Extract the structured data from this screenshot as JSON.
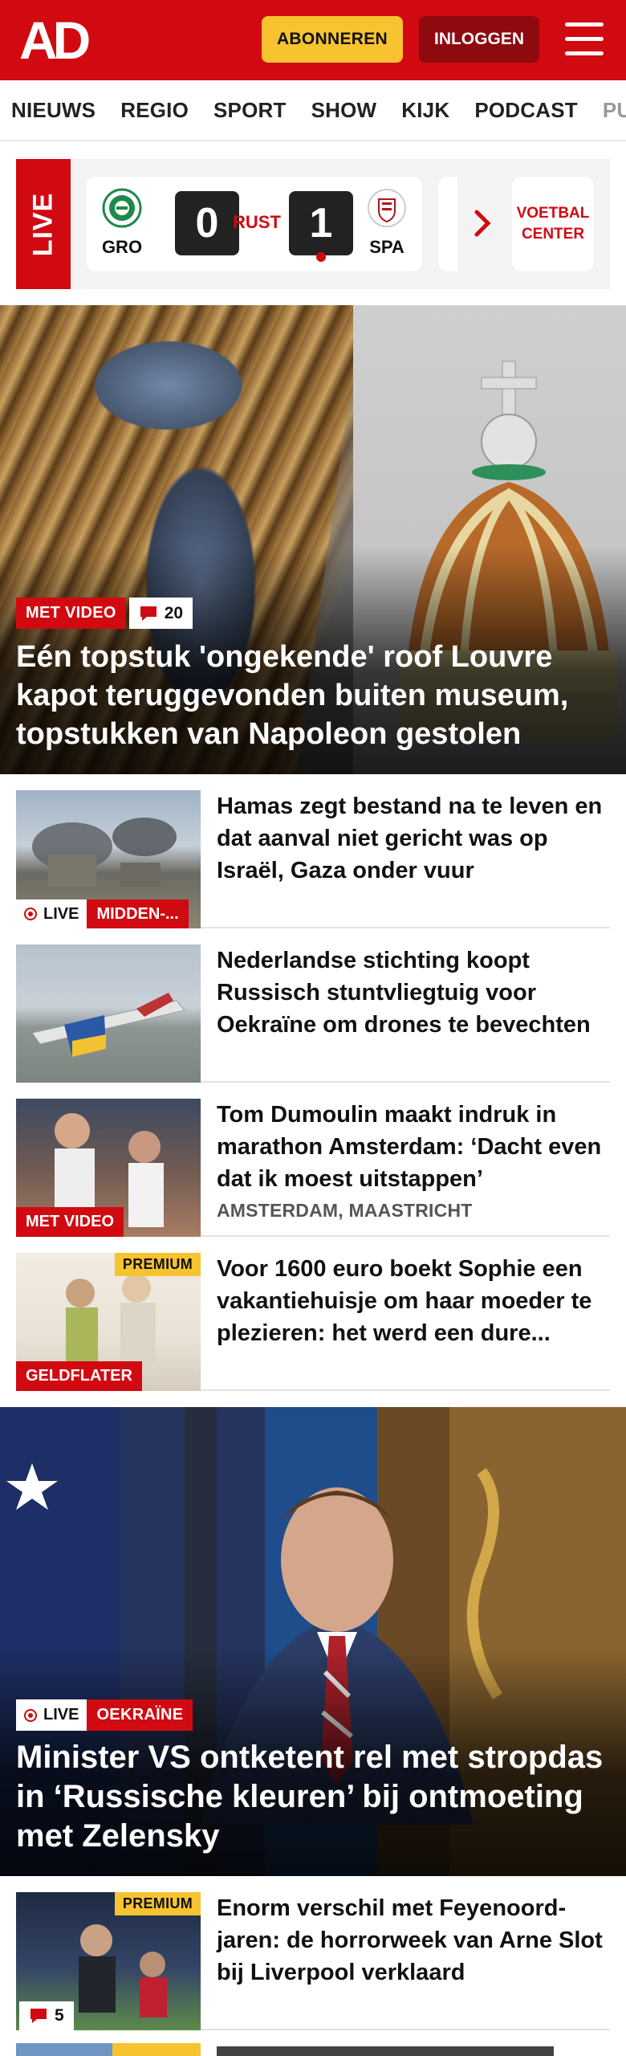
{
  "header": {
    "logo": "AD",
    "subscribe_label": "ABONNEREN",
    "login_label": "INLOGGEN"
  },
  "nav": {
    "items": [
      "NIEUWS",
      "REGIO",
      "SPORT",
      "SHOW",
      "KIJK",
      "PODCAST",
      "PUZZ"
    ]
  },
  "live_scores": {
    "live_label": "LIVE",
    "match": {
      "home": "GRO",
      "away": "SPA",
      "home_score": "0",
      "away_score": "1",
      "status": "RUST"
    },
    "voetbal_center": "VOETBAL CENTER"
  },
  "hero": {
    "tag": "MET VIDEO",
    "comments": "20",
    "title": "Eén topstuk 'ongekende' roof Louvre kapot teruggevonden buiten museum, topstukken van Napoleon gestolen"
  },
  "articles": [
    {
      "title": "Hamas zegt bestand na te leven en dat aanval niet gericht was op Israël, Gaza onder vuur",
      "live": "LIVE",
      "tag": "MIDDEN-..."
    },
    {
      "title": "Nederlandse stichting koopt Russisch stuntvliegtuig voor Oekraïne om drones te bevechten"
    },
    {
      "title": "Tom Dumoulin maakt indruk in marathon Amsterdam: ‘Dacht even dat ik moest uitstappen’",
      "subtitle": "AMSTERDAM, MAASTRICHT",
      "tag": "MET VIDEO"
    },
    {
      "title": "Voor 1600 euro boekt Sophie een vakantiehuisje om haar moeder te plezieren: het werd een dure...",
      "premium": "PREMIUM",
      "tag": "GELDFLATER"
    }
  ],
  "hero2": {
    "live": "LIVE",
    "tag": "OEKRAÏNE",
    "title": "Minister VS ontketent rel met stropdas in ‘Russische kleuren’ bij ontmoeting met Zelensky"
  },
  "article_last": {
    "title": "Enorm verschil met Feyenoord-jaren: de horrorweek van Arne Slot bij Liverpool verklaard",
    "premium": "PREMIUM",
    "comments": "5"
  },
  "colors": {
    "brand_red": "#d10a11",
    "subscribe_yellow": "#f7c331",
    "login_dark_red": "#8e0a0e"
  }
}
